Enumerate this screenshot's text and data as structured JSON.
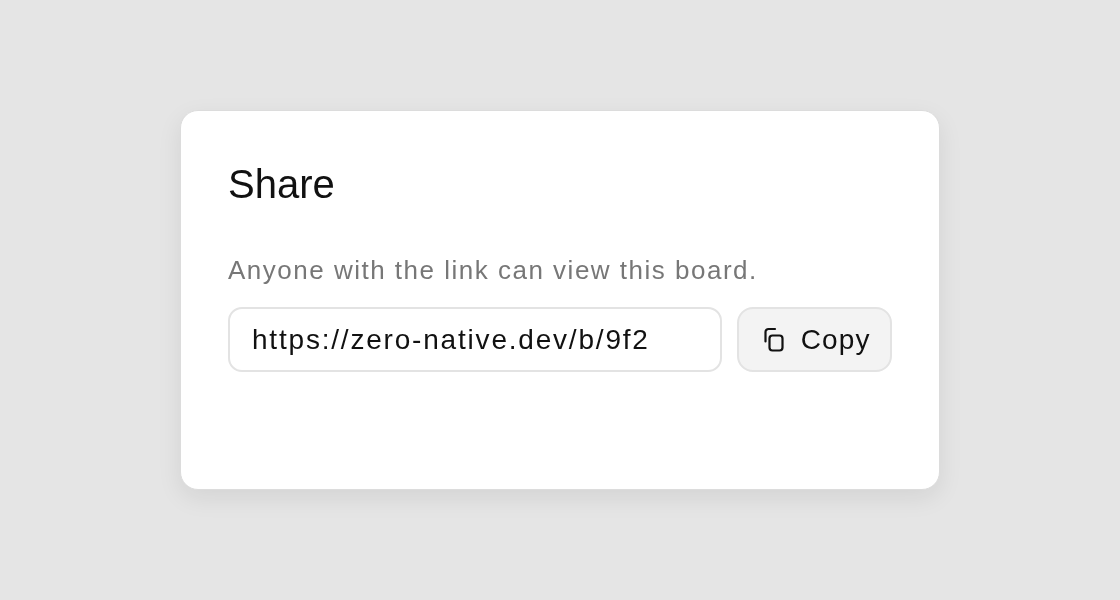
{
  "dialog": {
    "title": "Share",
    "description": "Anyone with the link can view this board.",
    "link_field": {
      "value": "https://zero-native.dev/b/9f2"
    },
    "copy_button": {
      "label": "Copy"
    }
  }
}
